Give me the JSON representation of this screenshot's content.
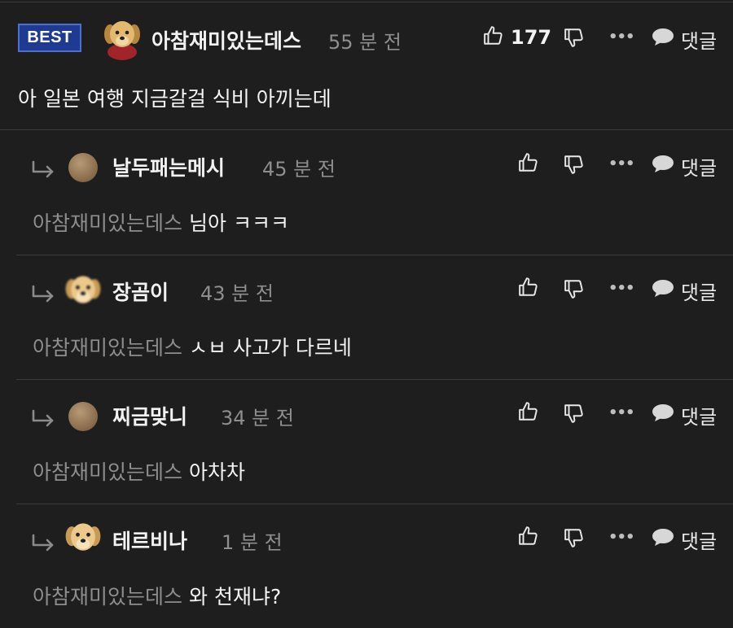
{
  "best_comment": {
    "badge": "BEST",
    "author": "아참재미있는데스",
    "time": "55 분 전",
    "likes": "177",
    "reply_label": "댓글",
    "more_label": "•••",
    "text": "아 일본 여행 지금갈걸 식비 아끼는데"
  },
  "replies": [
    {
      "author": "날두패는메시",
      "time": "45 분 전",
      "mention": "아참재미있는데스",
      "text": "님아 ㅋㅋㅋ",
      "reply_label": "댓글",
      "more_label": "•••",
      "avatar": "plain"
    },
    {
      "author": "장곰이",
      "time": "43 분 전",
      "mention": "아참재미있는데스",
      "text": "ㅅㅂ 사고가 다르네",
      "reply_label": "댓글",
      "more_label": "•••",
      "avatar": "dog-blur"
    },
    {
      "author": "찌금맞니",
      "time": "34 분 전",
      "mention": "아참재미있는데스",
      "text": "아차차",
      "reply_label": "댓글",
      "more_label": "•••",
      "avatar": "plain"
    },
    {
      "author": "테르비나",
      "time": "1 분 전",
      "mention": "아참재미있는데스",
      "text": "와 천재냐?",
      "reply_label": "댓글",
      "more_label": "•••",
      "avatar": "dog"
    }
  ]
}
